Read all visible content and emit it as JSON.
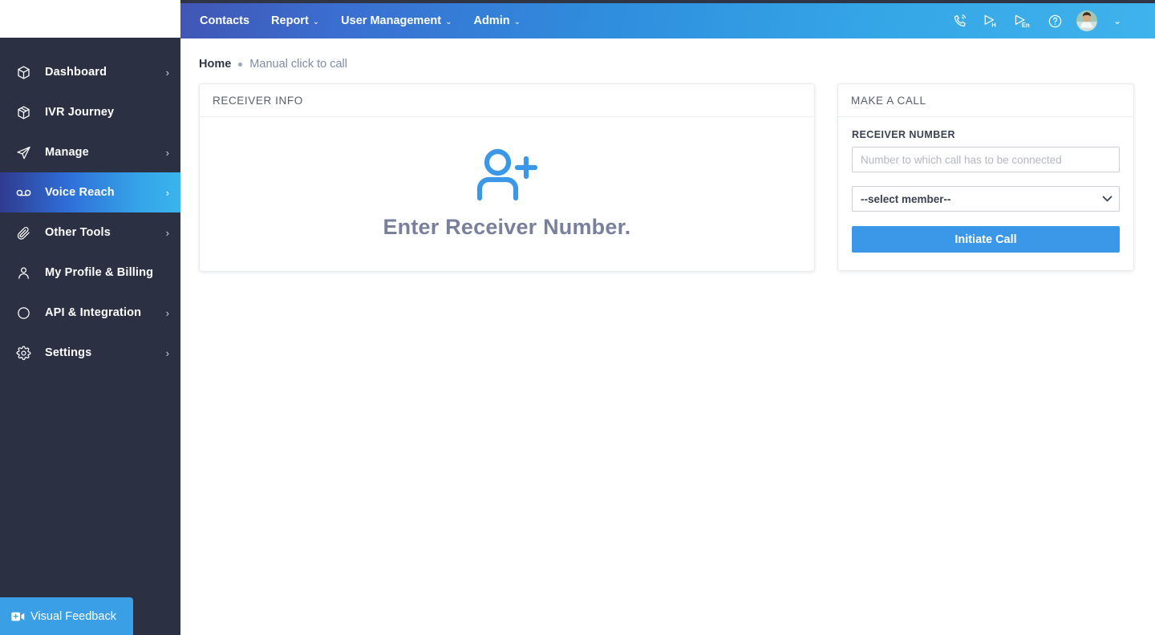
{
  "sidebar": {
    "items": [
      {
        "label": "Dashboard",
        "icon": "cube-icon",
        "has_chevron": true,
        "active": false
      },
      {
        "label": "IVR Journey",
        "icon": "box-icon",
        "has_chevron": false,
        "active": false
      },
      {
        "label": "Manage",
        "icon": "send-icon",
        "has_chevron": true,
        "active": false
      },
      {
        "label": "Voice Reach",
        "icon": "voicemail-icon",
        "has_chevron": true,
        "active": true
      },
      {
        "label": "Other Tools",
        "icon": "paperclip-icon",
        "has_chevron": true,
        "active": false
      },
      {
        "label": "My Profile & Billing",
        "icon": "user-icon",
        "has_chevron": false,
        "active": false
      },
      {
        "label": "API & Integration",
        "icon": "circle-icon",
        "has_chevron": true,
        "active": false
      },
      {
        "label": "Settings",
        "icon": "gear-icon",
        "has_chevron": true,
        "active": false
      }
    ],
    "chevron_glyph": "›",
    "visual_feedback": {
      "label": "Visual Feedback",
      "icon": "video-camera-icon"
    },
    "colors": {
      "background": "#2b3143",
      "active_from": "#2f3b8f",
      "active_to": "#3ab4ec",
      "feedback_bg": "#3b9fe5"
    }
  },
  "header": {
    "menu": [
      {
        "label": "Contacts",
        "has_caret": false
      },
      {
        "label": "Report",
        "has_caret": true
      },
      {
        "label": "User Management",
        "has_caret": true
      },
      {
        "label": "Admin",
        "has_caret": true
      }
    ],
    "caret_glyph": "⌄",
    "icons": [
      {
        "name": "phone-ring-icon",
        "title": "Call"
      },
      {
        "name": "play-hindi-icon",
        "title": "H"
      },
      {
        "name": "play-english-icon",
        "title": "En"
      },
      {
        "name": "help-circle-icon",
        "title": "Help"
      }
    ],
    "avatar": {
      "name": "user-avatar",
      "caret_glyph": "⌄"
    },
    "colors": {
      "gradient_from": "#4156b4",
      "gradient_to": "#3fb3ec"
    }
  },
  "breadcrumb": {
    "home": "Home",
    "current": "Manual click to call"
  },
  "receiver_card": {
    "title": "RECEIVER INFO",
    "empty_icon": "user-plus-icon",
    "empty_text": "Enter Receiver Number.",
    "icon_color": "#3b97e8"
  },
  "call_card": {
    "title": "MAKE A CALL",
    "number_label": "RECEIVER NUMBER",
    "number_value": "",
    "number_placeholder": "Number to which call has to be connected",
    "member_selected": "--select member--",
    "member_options": [
      "--select member--"
    ],
    "initiate_label": "Initiate Call",
    "button_color": "#3b97e8"
  }
}
